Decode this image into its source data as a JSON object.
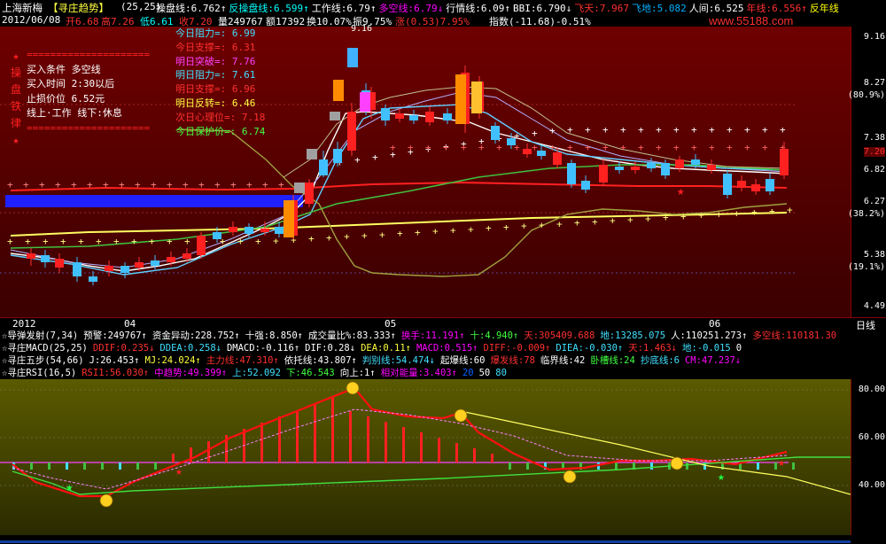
{
  "header": {
    "stock_name": "上海新梅",
    "indicator": "【寻庄趋势】",
    "params": "(25,25)",
    "items": [
      {
        "text": "操盘线:6.762↑",
        "color": "#ffffff"
      },
      {
        "text": "反操盘线:6.599↑",
        "color": "#00ffff"
      },
      {
        "text": "工作线:6.79↑",
        "color": "#ffffff"
      },
      {
        "text": "多空线:6.79↓",
        "color": "#ff00ff"
      },
      {
        "text": "行情线:6.09↑",
        "color": "#ffffff"
      },
      {
        "text": "BBI:6.790↓",
        "color": "#ffffff"
      },
      {
        "text": "飞天:7.967",
        "color": "#ff3030"
      },
      {
        "text": "飞地:5.082",
        "color": "#00b0ff"
      },
      {
        "text": "人间:6.525",
        "color": "#ffffff"
      },
      {
        "text": "年线:6.556↑",
        "color": "#ff3030"
      },
      {
        "text": "反年线",
        "color": "#ffff00"
      }
    ]
  },
  "info": {
    "date": "2012/06/08",
    "open": "开6.68",
    "high": "高7.26",
    "low": "低6.61",
    "close": "收7.20",
    "volume": "量249767",
    "amount": "额17392",
    "turnover": "换10.07%",
    "amplitude": "振9.75%",
    "change": "涨(0.53)7.95%",
    "index": "指数(-11.68)-0.51%"
  },
  "watermark": "www.55188.com",
  "main_axis": [
    "9.16",
    "8.27",
    "(80.9%)",
    "7.38",
    "7.20",
    "6.82",
    "6.27",
    "(38.2%)",
    "5.38",
    "(19.1%)",
    "4.49"
  ],
  "peak_label": "9.16",
  "left_box": {
    "lines": [
      "=====================",
      "买入条件    多空线",
      "买入时间    2:30以后",
      "止损价位    6.52元",
      "线上·工作   线下:休息",
      "====================="
    ],
    "side_chars": [
      "★",
      "操",
      "盘",
      "铁",
      "律",
      "★"
    ]
  },
  "right_box": [
    {
      "text": "今日阻力=: 6.99",
      "color": "#40e0ff"
    },
    {
      "text": "今日支撑=: 6.31",
      "color": "#ff3030"
    },
    {
      "text": "明日突破=: 7.76",
      "color": "#ff40ff"
    },
    {
      "text": "明日阻力=: 7.61",
      "color": "#40e0ff"
    },
    {
      "text": "明日支撑=: 6.96",
      "color": "#ff3030"
    },
    {
      "text": "明日反转=: 6.46",
      "color": "#ffff40"
    },
    {
      "text": "次日心理位=: 7.18",
      "color": "#ff3030"
    },
    {
      "text": "今日保护价=: 6.74",
      "color": "#40ff40"
    }
  ],
  "dates": [
    "2012",
    "04",
    "05",
    "06"
  ],
  "datebar_right": "日线",
  "indicators": [
    {
      "name": "☆导弹发射",
      "params": "(7,34)",
      "values": [
        {
          "t": "预警:249767↑",
          "c": "#ffffff"
        },
        {
          "t": "资金异动:228.752↑",
          "c": "#ffffff"
        },
        {
          "t": "十强:8.850↑",
          "c": "#ffffff"
        },
        {
          "t": "成交量比%:83.333↑",
          "c": "#ffffff"
        },
        {
          "t": "换手:11.191↑",
          "c": "#ff00ff"
        },
        {
          "t": "十:4.940↑",
          "c": "#40ff40"
        },
        {
          "t": "天:305409.688",
          "c": "#ff3030"
        },
        {
          "t": "地:13285.075",
          "c": "#40e0ff"
        },
        {
          "t": "人:110251.273↑",
          "c": "#ffffff"
        },
        {
          "t": "多空线:110181.30",
          "c": "#ff3030"
        }
      ]
    },
    {
      "name": "☆寻庄MACD",
      "params": "(25,25)",
      "values": [
        {
          "t": "DDIF:0.235↓",
          "c": "#ff3030"
        },
        {
          "t": "DDEA:0.258↓",
          "c": "#40e0ff"
        },
        {
          "t": "DMACD:-0.116↑",
          "c": "#ffffff"
        },
        {
          "t": "DIF:0.28↓",
          "c": "#ffffff"
        },
        {
          "t": "DEA:0.11↑",
          "c": "#ffff40"
        },
        {
          "t": "MACD:0.515↑",
          "c": "#ff00ff"
        },
        {
          "t": "DIFF:-0.009↑",
          "c": "#ff3030"
        },
        {
          "t": "DIEA:-0.030↑",
          "c": "#40e0ff"
        },
        {
          "t": "天:1.463↓",
          "c": "#ff3030"
        },
        {
          "t": "地:-0.015",
          "c": "#40e0ff"
        },
        {
          "t": "0",
          "c": "#ffffff"
        }
      ]
    },
    {
      "name": "☆寻庄五步",
      "params": "(54,66)",
      "values": [
        {
          "t": "J:26.453↑",
          "c": "#ffffff"
        },
        {
          "t": "MJ:24.024↑",
          "c": "#ffff40"
        },
        {
          "t": "主力线:47.310↑",
          "c": "#ff3030"
        },
        {
          "t": "依托线:43.807↑",
          "c": "#ffffff"
        },
        {
          "t": "判别线:54.474↓",
          "c": "#40e0ff"
        },
        {
          "t": "起爆线:60",
          "c": "#ffffff"
        },
        {
          "t": "爆发线:78",
          "c": "#ff3030"
        },
        {
          "t": "临界线:42",
          "c": "#ffffff"
        },
        {
          "t": "卧槽线:24",
          "c": "#40ff40"
        },
        {
          "t": "抄底线:6",
          "c": "#40e0ff"
        },
        {
          "t": "CM:47.237↓",
          "c": "#ff00ff"
        }
      ]
    },
    {
      "name": "☆寻庄RSI",
      "params": "(16,5)",
      "values": [
        {
          "t": "RSI1:56.030↑",
          "c": "#ff3030"
        },
        {
          "t": "中趋势:49.399↑",
          "c": "#ff00ff"
        },
        {
          "t": "上:52.092",
          "c": "#40e0ff"
        },
        {
          "t": "下:46.543",
          "c": "#40ff40"
        },
        {
          "t": "向上:1↑",
          "c": "#ffffff"
        },
        {
          "t": "相对能量:3.403↑",
          "c": "#ff00ff"
        },
        {
          "t": "20",
          "c": "#0060ff"
        },
        {
          "t": "50",
          "c": "#ffffff"
        },
        {
          "t": "80",
          "c": "#40e0ff"
        }
      ]
    }
  ],
  "low_axis": [
    "80.00",
    "60.00",
    "40.00"
  ],
  "colors": {
    "up": "#ff3030",
    "down": "#00e0ff",
    "bg_main": "#5a0000",
    "bg_low": "#3f3f00"
  }
}
